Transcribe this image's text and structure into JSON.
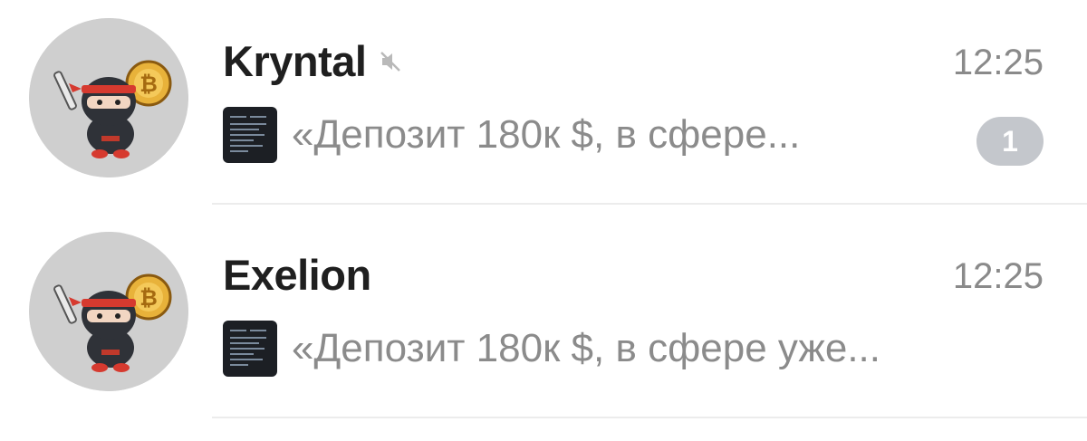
{
  "chats": [
    {
      "name": "Kryntal",
      "muted": true,
      "time": "12:25",
      "preview": "«Депозит 180к $, в сфере...",
      "unread_count": "1",
      "avatar_icon": "ninja-bitcoin-icon"
    },
    {
      "name": "Exelion",
      "muted": false,
      "time": "12:25",
      "preview": "«Депозит 180к $, в сфере уже...",
      "avatar_icon": "ninja-bitcoin-icon"
    }
  ],
  "colors": {
    "name": "#1f1f1f",
    "secondary": "#8a8a8a",
    "badge": "#c4c7cc",
    "avatar_bg": "#cfcfcf",
    "divider": "#ececec"
  }
}
